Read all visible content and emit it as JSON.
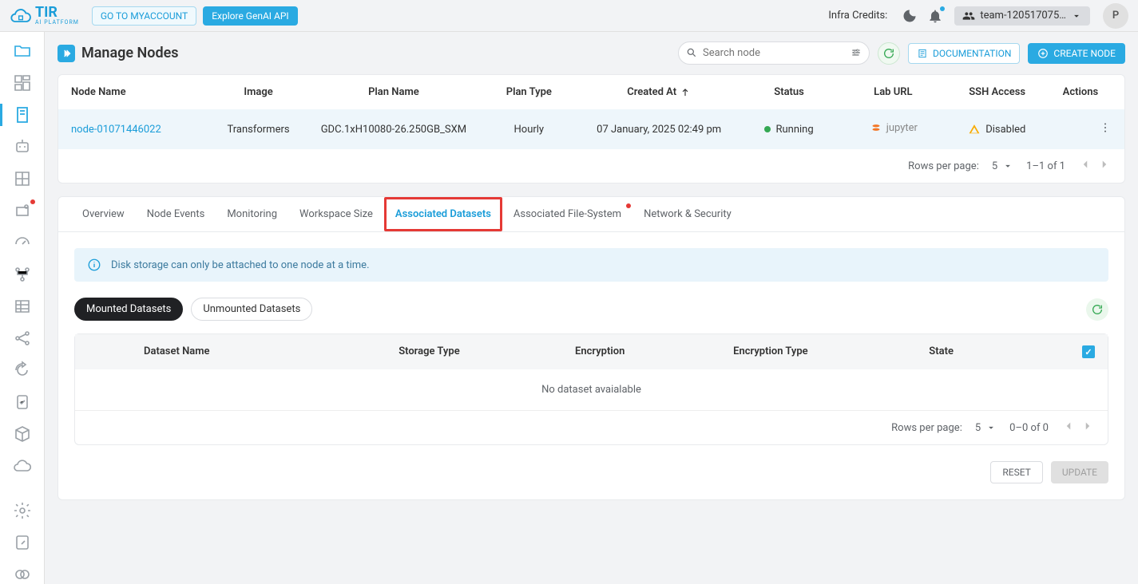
{
  "brand": {
    "name": "TIR",
    "sub": "AI PLATFORM"
  },
  "topbar": {
    "myaccount": "GO TO MYACCOUNT",
    "explore": "Explore GenAI API",
    "infra_label": "Infra Credits:",
    "team": "team-120517075…",
    "avatar": "P"
  },
  "page": {
    "title": "Manage Nodes",
    "search_placeholder": "Search node",
    "documentation": "DOCUMENTATION",
    "create": "CREATE NODE"
  },
  "nodes_table": {
    "headers": {
      "name": "Node Name",
      "image": "Image",
      "plan": "Plan Name",
      "plan_type": "Plan Type",
      "created": "Created At",
      "status": "Status",
      "lab": "Lab URL",
      "ssh": "SSH Access",
      "actions": "Actions"
    },
    "row": {
      "name": "node-01071446022",
      "image": "Transformers",
      "plan": "GDC.1xH10080-26.250GB_SXM",
      "plan_type": "Hourly",
      "created": "07 January, 2025 02:49 pm",
      "status": "Running",
      "lab": "jupyter",
      "ssh": "Disabled"
    },
    "footer": {
      "rpp_label": "Rows per page:",
      "rpp_value": "5",
      "range": "1–1 of 1"
    }
  },
  "tabs": {
    "overview": "Overview",
    "events": "Node Events",
    "monitoring": "Monitoring",
    "workspace": "Workspace Size",
    "datasets": "Associated Datasets",
    "filesystem": "Associated File-System",
    "network": "Network & Security"
  },
  "datasets": {
    "info": "Disk storage can only be attached to one node at a time.",
    "pill_mounted": "Mounted Datasets",
    "pill_unmounted": "Unmounted Datasets",
    "headers": {
      "name": "Dataset Name",
      "storage": "Storage Type",
      "encryption": "Encryption",
      "enc_type": "Encryption Type",
      "state": "State"
    },
    "empty": "No dataset avaialable",
    "footer": {
      "rpp_label": "Rows per page:",
      "rpp_value": "5",
      "range": "0–0 of 0"
    },
    "reset": "RESET",
    "update": "UPDATE"
  }
}
